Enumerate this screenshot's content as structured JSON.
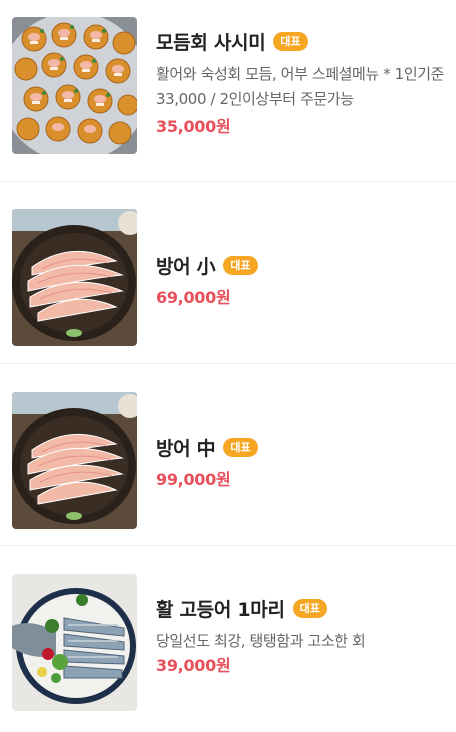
{
  "menu": {
    "items": [
      {
        "name": "모듬회 사시미",
        "badge": "대표",
        "description": "활어와 숙성회 모듬, 어부 스페셜메뉴 * 1인기준 33,000 / 2인이상부터 주문가능",
        "price": "35,000원",
        "image": "sashimi-platter-image"
      },
      {
        "name": "방어 小",
        "badge": "대표",
        "price": "69,000원",
        "image": "yellowtail-plate-image"
      },
      {
        "name": "방어 中",
        "badge": "대표",
        "price": "99,000원",
        "image": "yellowtail-plate-image"
      },
      {
        "name": "활 고등어 1마리",
        "badge": "대표",
        "description": "당일선도 최강, 탱탱함과 고소한 회",
        "price": "39,000원",
        "image": "mackerel-plate-image"
      }
    ]
  },
  "colors": {
    "badge": "#f5a623",
    "price": "#e8505b",
    "title": "#222222",
    "description": "#666666",
    "divider": "#eeeeee"
  }
}
